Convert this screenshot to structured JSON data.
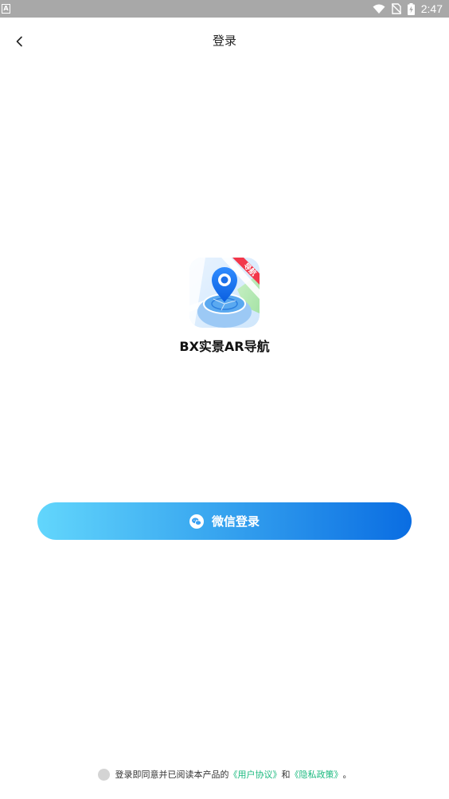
{
  "status_bar": {
    "left_icon": "A",
    "time": "2:47",
    "icons": [
      "wifi-icon",
      "no-sim-icon",
      "battery-charging-icon"
    ]
  },
  "header": {
    "title": "登录",
    "back_icon": "chevron-left-icon"
  },
  "app": {
    "name": "BX实景AR导航",
    "logo_badge": "导航"
  },
  "login": {
    "wechat_label": "微信登录",
    "wechat_icon": "wechat-icon"
  },
  "agreement": {
    "prefix": "登录即同意并已阅读本产品的",
    "user_agreement": "《用户协议》",
    "conjunction": "和",
    "privacy_policy": "《隐私政策》",
    "suffix": "。",
    "checked": false
  },
  "colors": {
    "status_bar": "#a8a8a8",
    "button_gradient_start": "#62d6fc",
    "button_gradient_end": "#0a6de2",
    "link": "#19b97e",
    "checkbox": "#d4d4d4"
  }
}
